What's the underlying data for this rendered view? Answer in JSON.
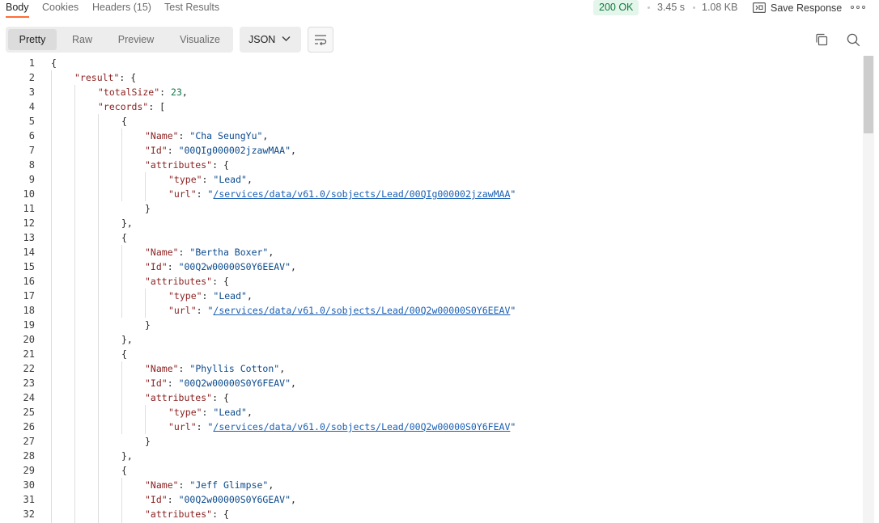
{
  "tabs": [
    {
      "label": "Body",
      "active": true
    },
    {
      "label": "Cookies",
      "active": false
    },
    {
      "label": "Headers (15)",
      "active": false
    },
    {
      "label": "Test Results",
      "active": false
    }
  ],
  "status": {
    "code_text": "200 OK",
    "time": "3.45 s",
    "size": "1.08 KB",
    "status_color": "#0d7a3a"
  },
  "save_response": {
    "label": "Save Response",
    "icon": "save-response-icon"
  },
  "view_modes": [
    {
      "label": "Pretty",
      "active": true
    },
    {
      "label": "Raw",
      "active": false
    },
    {
      "label": "Preview",
      "active": false
    },
    {
      "label": "Visualize",
      "active": false
    }
  ],
  "format": {
    "selected": "JSON"
  },
  "colors": {
    "accent": "#ff6c37",
    "json_key": "#8a1f1f",
    "json_string": "#0b4a8c",
    "json_number": "#0e7a4a",
    "json_link": "#1a5fb4"
  },
  "code": {
    "lines": [
      {
        "n": "1",
        "indent": 0,
        "tokens": [
          {
            "t": "p",
            "v": "{"
          }
        ]
      },
      {
        "n": "2",
        "indent": 1,
        "tokens": [
          {
            "t": "k",
            "v": "\"result\""
          },
          {
            "t": "p",
            "v": ": {"
          }
        ]
      },
      {
        "n": "3",
        "indent": 2,
        "tokens": [
          {
            "t": "k",
            "v": "\"totalSize\""
          },
          {
            "t": "p",
            "v": ": "
          },
          {
            "t": "n",
            "v": "23"
          },
          {
            "t": "p",
            "v": ","
          }
        ]
      },
      {
        "n": "4",
        "indent": 2,
        "tokens": [
          {
            "t": "k",
            "v": "\"records\""
          },
          {
            "t": "p",
            "v": ": ["
          }
        ]
      },
      {
        "n": "5",
        "indent": 3,
        "tokens": [
          {
            "t": "p",
            "v": "{"
          }
        ]
      },
      {
        "n": "6",
        "indent": 4,
        "tokens": [
          {
            "t": "k",
            "v": "\"Name\""
          },
          {
            "t": "p",
            "v": ": "
          },
          {
            "t": "s",
            "v": "\"Cha SeungYu\""
          },
          {
            "t": "p",
            "v": ","
          }
        ]
      },
      {
        "n": "7",
        "indent": 4,
        "tokens": [
          {
            "t": "k",
            "v": "\"Id\""
          },
          {
            "t": "p",
            "v": ": "
          },
          {
            "t": "s",
            "v": "\"00QIg000002jzawMAA\""
          },
          {
            "t": "p",
            "v": ","
          }
        ]
      },
      {
        "n": "8",
        "indent": 4,
        "tokens": [
          {
            "t": "k",
            "v": "\"attributes\""
          },
          {
            "t": "p",
            "v": ": {"
          }
        ]
      },
      {
        "n": "9",
        "indent": 5,
        "tokens": [
          {
            "t": "k",
            "v": "\"type\""
          },
          {
            "t": "p",
            "v": ": "
          },
          {
            "t": "s",
            "v": "\"Lead\""
          },
          {
            "t": "p",
            "v": ","
          }
        ]
      },
      {
        "n": "10",
        "indent": 5,
        "tokens": [
          {
            "t": "k",
            "v": "\"url\""
          },
          {
            "t": "p",
            "v": ": "
          },
          {
            "t": "s",
            "v": "\""
          },
          {
            "t": "u",
            "v": "/services/data/v61.0/sobjects/Lead/00QIg000002jzawMAA"
          },
          {
            "t": "s",
            "v": "\""
          }
        ]
      },
      {
        "n": "11",
        "indent": 4,
        "tokens": [
          {
            "t": "p",
            "v": "}"
          }
        ]
      },
      {
        "n": "12",
        "indent": 3,
        "tokens": [
          {
            "t": "p",
            "v": "},"
          }
        ]
      },
      {
        "n": "13",
        "indent": 3,
        "tokens": [
          {
            "t": "p",
            "v": "{"
          }
        ]
      },
      {
        "n": "14",
        "indent": 4,
        "tokens": [
          {
            "t": "k",
            "v": "\"Name\""
          },
          {
            "t": "p",
            "v": ": "
          },
          {
            "t": "s",
            "v": "\"Bertha Boxer\""
          },
          {
            "t": "p",
            "v": ","
          }
        ]
      },
      {
        "n": "15",
        "indent": 4,
        "tokens": [
          {
            "t": "k",
            "v": "\"Id\""
          },
          {
            "t": "p",
            "v": ": "
          },
          {
            "t": "s",
            "v": "\"00Q2w00000S0Y6EEAV\""
          },
          {
            "t": "p",
            "v": ","
          }
        ]
      },
      {
        "n": "16",
        "indent": 4,
        "tokens": [
          {
            "t": "k",
            "v": "\"attributes\""
          },
          {
            "t": "p",
            "v": ": {"
          }
        ]
      },
      {
        "n": "17",
        "indent": 5,
        "tokens": [
          {
            "t": "k",
            "v": "\"type\""
          },
          {
            "t": "p",
            "v": ": "
          },
          {
            "t": "s",
            "v": "\"Lead\""
          },
          {
            "t": "p",
            "v": ","
          }
        ]
      },
      {
        "n": "18",
        "indent": 5,
        "tokens": [
          {
            "t": "k",
            "v": "\"url\""
          },
          {
            "t": "p",
            "v": ": "
          },
          {
            "t": "s",
            "v": "\""
          },
          {
            "t": "u",
            "v": "/services/data/v61.0/sobjects/Lead/00Q2w00000S0Y6EEAV"
          },
          {
            "t": "s",
            "v": "\""
          }
        ]
      },
      {
        "n": "19",
        "indent": 4,
        "tokens": [
          {
            "t": "p",
            "v": "}"
          }
        ]
      },
      {
        "n": "20",
        "indent": 3,
        "tokens": [
          {
            "t": "p",
            "v": "},"
          }
        ]
      },
      {
        "n": "21",
        "indent": 3,
        "tokens": [
          {
            "t": "p",
            "v": "{"
          }
        ]
      },
      {
        "n": "22",
        "indent": 4,
        "tokens": [
          {
            "t": "k",
            "v": "\"Name\""
          },
          {
            "t": "p",
            "v": ": "
          },
          {
            "t": "s",
            "v": "\"Phyllis Cotton\""
          },
          {
            "t": "p",
            "v": ","
          }
        ]
      },
      {
        "n": "23",
        "indent": 4,
        "tokens": [
          {
            "t": "k",
            "v": "\"Id\""
          },
          {
            "t": "p",
            "v": ": "
          },
          {
            "t": "s",
            "v": "\"00Q2w00000S0Y6FEAV\""
          },
          {
            "t": "p",
            "v": ","
          }
        ]
      },
      {
        "n": "24",
        "indent": 4,
        "tokens": [
          {
            "t": "k",
            "v": "\"attributes\""
          },
          {
            "t": "p",
            "v": ": {"
          }
        ]
      },
      {
        "n": "25",
        "indent": 5,
        "tokens": [
          {
            "t": "k",
            "v": "\"type\""
          },
          {
            "t": "p",
            "v": ": "
          },
          {
            "t": "s",
            "v": "\"Lead\""
          },
          {
            "t": "p",
            "v": ","
          }
        ]
      },
      {
        "n": "26",
        "indent": 5,
        "tokens": [
          {
            "t": "k",
            "v": "\"url\""
          },
          {
            "t": "p",
            "v": ": "
          },
          {
            "t": "s",
            "v": "\""
          },
          {
            "t": "u",
            "v": "/services/data/v61.0/sobjects/Lead/00Q2w00000S0Y6FEAV"
          },
          {
            "t": "s",
            "v": "\""
          }
        ]
      },
      {
        "n": "27",
        "indent": 4,
        "tokens": [
          {
            "t": "p",
            "v": "}"
          }
        ]
      },
      {
        "n": "28",
        "indent": 3,
        "tokens": [
          {
            "t": "p",
            "v": "},"
          }
        ]
      },
      {
        "n": "29",
        "indent": 3,
        "tokens": [
          {
            "t": "p",
            "v": "{"
          }
        ]
      },
      {
        "n": "30",
        "indent": 4,
        "tokens": [
          {
            "t": "k",
            "v": "\"Name\""
          },
          {
            "t": "p",
            "v": ": "
          },
          {
            "t": "s",
            "v": "\"Jeff Glimpse\""
          },
          {
            "t": "p",
            "v": ","
          }
        ]
      },
      {
        "n": "31",
        "indent": 4,
        "tokens": [
          {
            "t": "k",
            "v": "\"Id\""
          },
          {
            "t": "p",
            "v": ": "
          },
          {
            "t": "s",
            "v": "\"00Q2w00000S0Y6GEAV\""
          },
          {
            "t": "p",
            "v": ","
          }
        ]
      },
      {
        "n": "32",
        "indent": 4,
        "tokens": [
          {
            "t": "k",
            "v": "\"attributes\""
          },
          {
            "t": "p",
            "v": ": {"
          }
        ]
      }
    ]
  }
}
